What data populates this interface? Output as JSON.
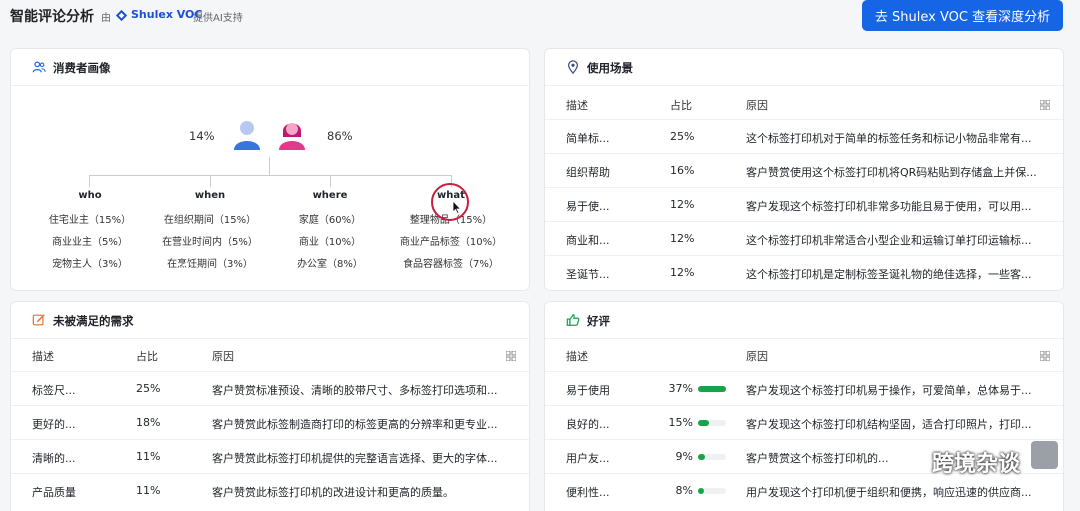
{
  "header": {
    "title": "智能评论分析",
    "by": "由",
    "brand": "Shulex VOC",
    "ai_note": "提供AI支持",
    "cta": "去 Shulex VOC 查看深度分析"
  },
  "persona": {
    "title": "消费者画像",
    "male_pct": "14%",
    "female_pct": "86%",
    "columns": [
      {
        "head": "who",
        "items": [
          "住宅业主（15%）",
          "商业业主（5%）",
          "宠物主人（3%）"
        ]
      },
      {
        "head": "when",
        "items": [
          "在组织期间（15%）",
          "在营业时间内（5%）",
          "在烹饪期间（3%）"
        ]
      },
      {
        "head": "where",
        "items": [
          "家庭（60%）",
          "商业（10%）",
          "办公室（8%）"
        ]
      },
      {
        "head": "what",
        "items": [
          "整理物品（15%）",
          "商业产品标签（10%）",
          "食品容器标签（7%）"
        ]
      }
    ]
  },
  "scenes": {
    "title": "使用场景",
    "headers": [
      "描述",
      "占比",
      "原因"
    ],
    "rows": [
      {
        "desc": "简单标...",
        "pct": "25%",
        "reason": "这个标签打印机对于简单的标签任务和标记小物品非常有..."
      },
      {
        "desc": "组织帮助",
        "pct": "16%",
        "reason": "客户赞赏使用这个标签打印机将QR码粘贴到存储盒上并保..."
      },
      {
        "desc": "易于使...",
        "pct": "12%",
        "reason": "客户发现这个标签打印机非常多功能且易于使用，可以用..."
      },
      {
        "desc": "商业和...",
        "pct": "12%",
        "reason": "这个标签打印机非常适合小型企业和运输订单打印运输标..."
      },
      {
        "desc": "圣诞节...",
        "pct": "12%",
        "reason": "这个标签打印机是定制标签圣诞礼物的绝佳选择，一些客..."
      }
    ]
  },
  "needs": {
    "title": "未被满足的需求",
    "headers": [
      "描述",
      "占比",
      "原因"
    ],
    "rows": [
      {
        "desc": "标签尺...",
        "pct": "25%",
        "reason": "客户赞赏标准预设、清晰的胶带尺寸、多标签打印选项和..."
      },
      {
        "desc": "更好的...",
        "pct": "18%",
        "reason": "客户赞赏此标签制造商打印的标签更高的分辨率和更专业..."
      },
      {
        "desc": "清晰的...",
        "pct": "11%",
        "reason": "客户赞赏此标签打印机提供的完整语言选择、更大的字体..."
      },
      {
        "desc": "产品质量",
        "pct": "11%",
        "reason": "客户赞赏此标签打印机的改进设计和更高的质量。"
      }
    ]
  },
  "praise": {
    "title": "好评",
    "headers": [
      "描述",
      "占比",
      "原因"
    ],
    "rows": [
      {
        "desc": "易于使用",
        "pct": "37%",
        "value": 0.37,
        "reason": "客户发现这个标签打印机易于操作，可爱简单，总体易于..."
      },
      {
        "desc": "良好的...",
        "pct": "15%",
        "value": 0.15,
        "reason": "客户发现这个标签打印机结构坚固，适合打印照片，打印..."
      },
      {
        "desc": "用户友...",
        "pct": "9%",
        "value": 0.09,
        "reason": "客户赞赏这个标签打印机的..."
      },
      {
        "desc": "便利性...",
        "pct": "8%",
        "value": 0.08,
        "reason": "用户发现这个打印机便于组织和便携，响应迅速的供应商..."
      }
    ]
  },
  "watermark": "跨境杂谈",
  "colors": {
    "accent": "#1565e6",
    "bar": "#16a34a"
  }
}
